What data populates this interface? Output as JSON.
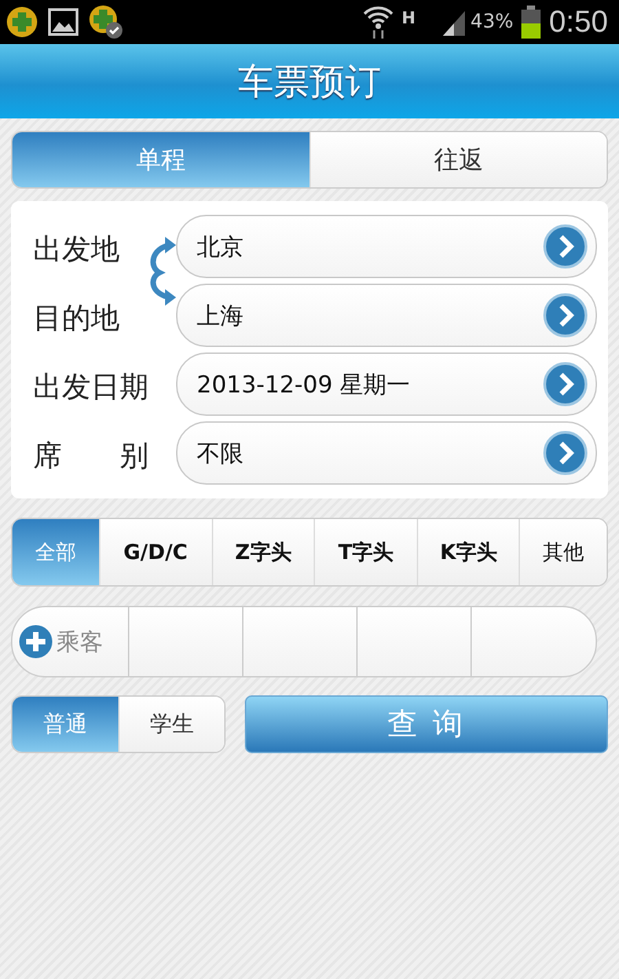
{
  "status_bar": {
    "network": "H",
    "battery": "43%",
    "time": "0:50"
  },
  "title": "车票预订",
  "trip_tabs": [
    {
      "label": "单程",
      "selected": true
    },
    {
      "label": "往返",
      "selected": false
    }
  ],
  "form": [
    {
      "label": "出发地",
      "value": "北京"
    },
    {
      "label": "目的地",
      "value": "上海"
    },
    {
      "label": "出发日期",
      "value": "2013-12-09 星期一"
    },
    {
      "label": "席　　别",
      "value": "不限"
    }
  ],
  "train_types": [
    {
      "label": "全部",
      "selected": true
    },
    {
      "label": "G/D/C",
      "selected": false
    },
    {
      "label": "Z字头",
      "selected": false
    },
    {
      "label": "T字头",
      "selected": false
    },
    {
      "label": "K字头",
      "selected": false
    },
    {
      "label": "其他",
      "selected": false
    }
  ],
  "passengers": {
    "add_label": "乘客"
  },
  "ticket_types": [
    {
      "label": "普通",
      "selected": true
    },
    {
      "label": "学生",
      "selected": false
    }
  ],
  "search_button": "查 询"
}
